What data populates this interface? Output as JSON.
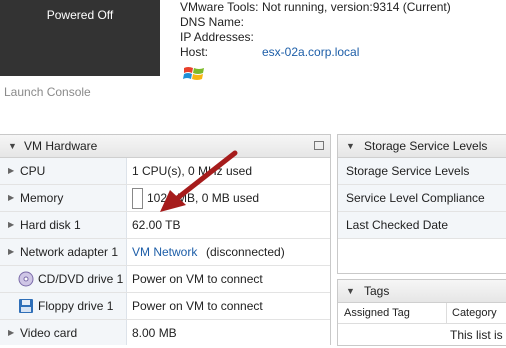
{
  "console": {
    "status": "Powered Off",
    "launch_label": "Launch Console"
  },
  "summary": [
    {
      "key": "VMware Tools:",
      "value": "Not running, version:9314 (Current)",
      "link": false
    },
    {
      "key": "DNS Name:",
      "value": "",
      "link": false
    },
    {
      "key": "IP Addresses:",
      "value": "",
      "link": false
    },
    {
      "key": "Host:",
      "value": "esx-02a.corp.local",
      "link": true
    }
  ],
  "hardware": {
    "title": "VM Hardware",
    "rows": [
      {
        "label": "CPU",
        "value": "1 CPU(s), 0 MHz used",
        "icon": ""
      },
      {
        "label": "Memory",
        "value": "1024 MB, 0 MB used",
        "icon": "memory-bar-icon"
      },
      {
        "label": "Hard disk 1",
        "value": "62.00 TB",
        "icon": ""
      },
      {
        "label": "Network adapter 1",
        "link": "VM Network",
        "value": "(disconnected)",
        "icon": ""
      },
      {
        "label": "CD/DVD drive 1",
        "value": "Power on VM to connect",
        "icon": "cd-dvd-icon"
      },
      {
        "label": "Floppy drive 1",
        "value": "Power on VM to connect",
        "icon": "floppy-icon"
      },
      {
        "label": "Video card",
        "value": "8.00 MB",
        "icon": ""
      }
    ]
  },
  "storage": {
    "title": "Storage Service Levels",
    "rows": [
      "Storage Service Levels",
      "Service Level Compliance",
      "Last Checked Date"
    ]
  },
  "tags": {
    "title": "Tags",
    "columns": [
      "Assigned Tag",
      "Category"
    ],
    "empty_note": "This list is"
  },
  "colors": {
    "link": "#1d5ea8",
    "annotation_arrow": "#a61c1c"
  }
}
